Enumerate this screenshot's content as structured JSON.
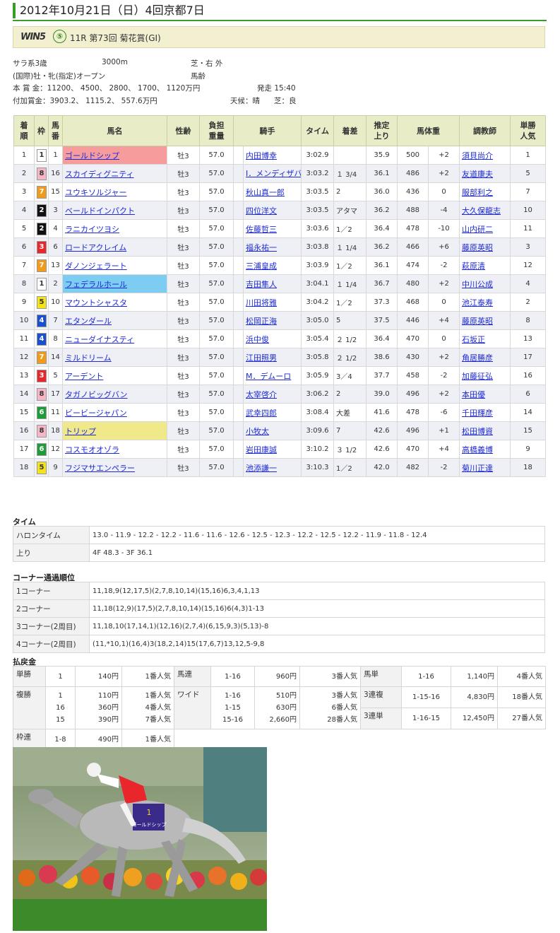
{
  "date_title": "2012年10月21日（日）4回京都7日",
  "race_header": {
    "logo": "WIN5",
    "logo_num": "⑤",
    "title": "11R 第73回 菊花賞(GI)"
  },
  "race_info": {
    "line1a": "サラ系3歳",
    "line1b": "3000m",
    "line1c": "芝・右 外",
    "line2a": "(国際)牡・牝(指定)オープン",
    "line2c": "馬齢",
    "line3a": "本 賞 金：11200、 4500、 2800、 1700、 1120万円",
    "line3c": "発走 15:40",
    "line4a": "付加賞金：3903.2、 1115.2、 557.6万円",
    "line4b": "天候：晴",
    "line4c": "芝：良"
  },
  "table_headers": {
    "finish": [
      "着",
      "順"
    ],
    "waku": "枠",
    "umaban": [
      "馬",
      "番"
    ],
    "horse": "馬名",
    "sexage": "性齢",
    "weight": [
      "負担",
      "重量"
    ],
    "jockey": "騎手",
    "time": "タイム",
    "margin": "着差",
    "last3f": [
      "推定",
      "上り"
    ],
    "bodyweight": "馬体重",
    "trainer": "調教師",
    "pop": [
      "単勝",
      "人気"
    ]
  },
  "results": [
    {
      "pos": "1",
      "waku": "1",
      "num": "1",
      "horse": "ゴールドシップ",
      "sexage": "牡3",
      "wt": "57.0",
      "jockey": "内田博幸",
      "time": "3:02.9",
      "margin": "",
      "last": "35.9",
      "bw": "500",
      "diff": "+2",
      "trainer": "須貝尚介",
      "pop": "1"
    },
    {
      "pos": "2",
      "waku": "8",
      "num": "16",
      "horse": "スカイディグニティ",
      "sexage": "牡3",
      "wt": "57.0",
      "jockey": "I．メンディザバル",
      "time": "3:03.2",
      "margin": "１ 3/4",
      "last": "36.1",
      "bw": "486",
      "diff": "+2",
      "trainer": "友道康夫",
      "pop": "5"
    },
    {
      "pos": "3",
      "waku": "7",
      "num": "15",
      "horse": "ユウキソルジャー",
      "sexage": "牡3",
      "wt": "57.0",
      "jockey": "秋山真一郎",
      "time": "3:03.5",
      "margin": "2",
      "last": "36.0",
      "bw": "436",
      "diff": "0",
      "trainer": "服部利之",
      "pop": "7"
    },
    {
      "pos": "4",
      "waku": "2",
      "num": "3",
      "horse": "ベールドインパクト",
      "sexage": "牡3",
      "wt": "57.0",
      "jockey": "四位洋文",
      "time": "3:03.5",
      "margin": "アタマ",
      "last": "36.2",
      "bw": "488",
      "diff": "-4",
      "trainer": "大久保龍志",
      "pop": "10"
    },
    {
      "pos": "5",
      "waku": "2",
      "num": "4",
      "horse": "ラニカイツヨシ",
      "sexage": "牡3",
      "wt": "57.0",
      "jockey": "佐藤哲三",
      "time": "3:03.6",
      "margin": "1／2",
      "last": "36.4",
      "bw": "478",
      "diff": "-10",
      "trainer": "山内研二",
      "pop": "11"
    },
    {
      "pos": "6",
      "waku": "3",
      "num": "6",
      "horse": "ロードアクレイム",
      "sexage": "牡3",
      "wt": "57.0",
      "jockey": "福永祐一",
      "time": "3:03.8",
      "margin": "１ 1/4",
      "last": "36.2",
      "bw": "466",
      "diff": "+6",
      "trainer": "藤原英昭",
      "pop": "3"
    },
    {
      "pos": "7",
      "waku": "7",
      "num": "13",
      "horse": "ダノンジェラート",
      "sexage": "牡3",
      "wt": "57.0",
      "jockey": "三浦皇成",
      "time": "3:03.9",
      "margin": "1／2",
      "last": "36.1",
      "bw": "474",
      "diff": "-2",
      "trainer": "萩原清",
      "pop": "12"
    },
    {
      "pos": "8",
      "waku": "1",
      "num": "2",
      "horse": "フェデラルホール",
      "sexage": "牡3",
      "wt": "57.0",
      "jockey": "吉田隼人",
      "time": "3:04.1",
      "margin": "１ 1/4",
      "last": "36.7",
      "bw": "480",
      "diff": "+2",
      "trainer": "中川公成",
      "pop": "4"
    },
    {
      "pos": "9",
      "waku": "5",
      "num": "10",
      "horse": "マウントシャスタ",
      "sexage": "牡3",
      "wt": "57.0",
      "jockey": "川田将雅",
      "time": "3:04.2",
      "margin": "1／2",
      "last": "37.3",
      "bw": "468",
      "diff": "0",
      "trainer": "池江泰寿",
      "pop": "2"
    },
    {
      "pos": "10",
      "waku": "4",
      "num": "7",
      "horse": "エタンダール",
      "sexage": "牡3",
      "wt": "57.0",
      "jockey": "松岡正海",
      "time": "3:05.0",
      "margin": "5",
      "last": "37.5",
      "bw": "446",
      "diff": "+4",
      "trainer": "藤原英昭",
      "pop": "8"
    },
    {
      "pos": "11",
      "waku": "4",
      "num": "8",
      "horse": "ニューダイナスティ",
      "sexage": "牡3",
      "wt": "57.0",
      "jockey": "浜中俊",
      "time": "3:05.4",
      "margin": "２ 1/2",
      "last": "36.4",
      "bw": "470",
      "diff": "0",
      "trainer": "石坂正",
      "pop": "13"
    },
    {
      "pos": "12",
      "waku": "7",
      "num": "14",
      "horse": "ミルドリーム",
      "sexage": "牡3",
      "wt": "57.0",
      "jockey": "江田照男",
      "time": "3:05.8",
      "margin": "２ 1/2",
      "last": "38.6",
      "bw": "430",
      "diff": "+2",
      "trainer": "角居勝彦",
      "pop": "17"
    },
    {
      "pos": "13",
      "waku": "3",
      "num": "5",
      "horse": "アーデント",
      "sexage": "牡3",
      "wt": "57.0",
      "jockey": "M．デムーロ",
      "time": "3:05.9",
      "margin": "3／4",
      "last": "37.7",
      "bw": "458",
      "diff": "-2",
      "trainer": "加藤征弘",
      "pop": "16"
    },
    {
      "pos": "14",
      "waku": "8",
      "num": "17",
      "horse": "タガノビッグバン",
      "sexage": "牡3",
      "wt": "57.0",
      "jockey": "太宰啓介",
      "time": "3:06.2",
      "margin": "2",
      "last": "39.0",
      "bw": "496",
      "diff": "+2",
      "trainer": "本田優",
      "pop": "6"
    },
    {
      "pos": "15",
      "waku": "6",
      "num": "11",
      "horse": "ビービージャパン",
      "sexage": "牡3",
      "wt": "57.0",
      "jockey": "武幸四郎",
      "time": "3:08.4",
      "margin": "大差",
      "last": "41.6",
      "bw": "478",
      "diff": "-6",
      "trainer": "千田輝彦",
      "pop": "14"
    },
    {
      "pos": "16",
      "waku": "8",
      "num": "18",
      "horse": "トリップ",
      "sexage": "牡3",
      "wt": "57.0",
      "jockey": "小牧太",
      "time": "3:09.6",
      "margin": "7",
      "last": "42.6",
      "bw": "496",
      "diff": "+1",
      "trainer": "松田博資",
      "pop": "15"
    },
    {
      "pos": "17",
      "waku": "6",
      "num": "12",
      "horse": "コスモオオゾラ",
      "sexage": "牡3",
      "wt": "57.0",
      "jockey": "岩田康誠",
      "time": "3:10.2",
      "margin": "３ 1/2",
      "last": "42.6",
      "bw": "470",
      "diff": "+4",
      "trainer": "高橋義博",
      "pop": "9"
    },
    {
      "pos": "18",
      "waku": "5",
      "num": "9",
      "horse": "フジマサエンペラー",
      "sexage": "牡3",
      "wt": "57.0",
      "jockey": "池添謙一",
      "time": "3:10.3",
      "margin": "1／2",
      "last": "42.0",
      "bw": "482",
      "diff": "-2",
      "trainer": "菊川正達",
      "pop": "18"
    }
  ],
  "highlights": {
    "0": "#f69c9c",
    "7": "#7ccdf1",
    "15": "#f0e989"
  },
  "waku_colors": {
    "1": {
      "bg": "#ffffff",
      "fg": "#333333"
    },
    "2": {
      "bg": "#111111",
      "fg": "#ffffff"
    },
    "3": {
      "bg": "#e8262b",
      "fg": "#ffffff"
    },
    "4": {
      "bg": "#1a4fcf",
      "fg": "#ffffff"
    },
    "5": {
      "bg": "#f5e31a",
      "fg": "#333333"
    },
    "6": {
      "bg": "#1f9c3a",
      "fg": "#ffffff"
    },
    "7": {
      "bg": "#f29a1a",
      "fg": "#ffffff"
    },
    "8": {
      "bg": "#f7b6c6",
      "fg": "#333333"
    }
  },
  "time_section": {
    "title": "タイム",
    "rows": [
      {
        "label": "ハロンタイム",
        "value": "13.0 - 11.9 - 12.2 - 12.2 - 11.6 - 11.6 - 12.6 - 12.5 - 12.3 - 12.2 - 12.5 - 12.2 - 11.9 - 11.8 - 12.4"
      },
      {
        "label": "上り",
        "value": "4F 48.3 - 3F 36.1"
      }
    ]
  },
  "corner_section": {
    "title": "コーナー通過順位",
    "rows": [
      {
        "label": "1コーナー",
        "value": "11,18,9(12,17,5)(2,7,8,10,14)(15,16)6,3,4,1,13"
      },
      {
        "label": "2コーナー",
        "value": "11,18(12,9)(17,5)(2,7,8,10,14)(15,16)6(4,3)1-13"
      },
      {
        "label": "3コーナー(2周目)",
        "value": "11,18,10(17,14,1)(12,16)(2,7,4)(6,15,9,3)(5,13)-8"
      },
      {
        "label": "4コーナー(2周目)",
        "value": "(11,*10,1)(16,4)3(18,2,14)15(17,6,7)13,12,5-9,8"
      }
    ]
  },
  "payout_section": {
    "title": "払戻金",
    "tansho": {
      "label": "単勝",
      "comb": "1",
      "pay": "140円",
      "pop": "1番人気"
    },
    "fukusho": {
      "label": "複勝",
      "comb": "1\n16\n15",
      "pay": "110円\n360円\n390円",
      "pop": "1番人気\n4番人気\n7番人気"
    },
    "wakuren": {
      "label": "枠連",
      "comb": "1-8",
      "pay": "490円",
      "pop": "1番人気"
    },
    "umaren": {
      "label": "馬連",
      "comb": "1-16",
      "pay": "960円",
      "pop": "3番人気"
    },
    "wide": {
      "label": "ワイド",
      "comb": "1-16\n1-15\n15-16",
      "pay": "510円\n630円\n2,660円",
      "pop": "3番人気\n6番人気\n28番人気"
    },
    "umatan": {
      "label": "馬単",
      "comb": "1-16",
      "pay": "1,140円",
      "pop": "4番人気"
    },
    "sanrenpuku": {
      "label": "3連複",
      "comb": "1-15-16",
      "pay": "4,830円",
      "pop": "18番人気"
    },
    "sanrentan": {
      "label": "3連単",
      "comb": "1-16-15",
      "pay": "12,450円",
      "pop": "27番人気"
    }
  },
  "photo": {
    "saddle_text": "ゴールドシップ",
    "saddle_num": "1"
  }
}
